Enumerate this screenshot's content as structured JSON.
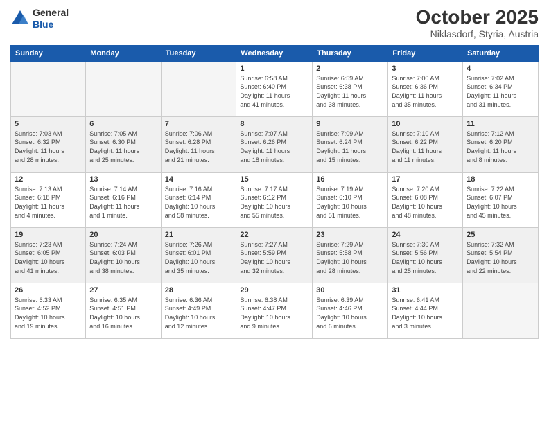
{
  "header": {
    "logo_line1": "General",
    "logo_line2": "Blue",
    "title": "October 2025",
    "subtitle": "Niklasdorf, Styria, Austria"
  },
  "days_of_week": [
    "Sunday",
    "Monday",
    "Tuesday",
    "Wednesday",
    "Thursday",
    "Friday",
    "Saturday"
  ],
  "weeks": [
    [
      {
        "day": "",
        "detail": ""
      },
      {
        "day": "",
        "detail": ""
      },
      {
        "day": "",
        "detail": ""
      },
      {
        "day": "1",
        "detail": "Sunrise: 6:58 AM\nSunset: 6:40 PM\nDaylight: 11 hours\nand 41 minutes."
      },
      {
        "day": "2",
        "detail": "Sunrise: 6:59 AM\nSunset: 6:38 PM\nDaylight: 11 hours\nand 38 minutes."
      },
      {
        "day": "3",
        "detail": "Sunrise: 7:00 AM\nSunset: 6:36 PM\nDaylight: 11 hours\nand 35 minutes."
      },
      {
        "day": "4",
        "detail": "Sunrise: 7:02 AM\nSunset: 6:34 PM\nDaylight: 11 hours\nand 31 minutes."
      }
    ],
    [
      {
        "day": "5",
        "detail": "Sunrise: 7:03 AM\nSunset: 6:32 PM\nDaylight: 11 hours\nand 28 minutes."
      },
      {
        "day": "6",
        "detail": "Sunrise: 7:05 AM\nSunset: 6:30 PM\nDaylight: 11 hours\nand 25 minutes."
      },
      {
        "day": "7",
        "detail": "Sunrise: 7:06 AM\nSunset: 6:28 PM\nDaylight: 11 hours\nand 21 minutes."
      },
      {
        "day": "8",
        "detail": "Sunrise: 7:07 AM\nSunset: 6:26 PM\nDaylight: 11 hours\nand 18 minutes."
      },
      {
        "day": "9",
        "detail": "Sunrise: 7:09 AM\nSunset: 6:24 PM\nDaylight: 11 hours\nand 15 minutes."
      },
      {
        "day": "10",
        "detail": "Sunrise: 7:10 AM\nSunset: 6:22 PM\nDaylight: 11 hours\nand 11 minutes."
      },
      {
        "day": "11",
        "detail": "Sunrise: 7:12 AM\nSunset: 6:20 PM\nDaylight: 11 hours\nand 8 minutes."
      }
    ],
    [
      {
        "day": "12",
        "detail": "Sunrise: 7:13 AM\nSunset: 6:18 PM\nDaylight: 11 hours\nand 4 minutes."
      },
      {
        "day": "13",
        "detail": "Sunrise: 7:14 AM\nSunset: 6:16 PM\nDaylight: 11 hours\nand 1 minute."
      },
      {
        "day": "14",
        "detail": "Sunrise: 7:16 AM\nSunset: 6:14 PM\nDaylight: 10 hours\nand 58 minutes."
      },
      {
        "day": "15",
        "detail": "Sunrise: 7:17 AM\nSunset: 6:12 PM\nDaylight: 10 hours\nand 55 minutes."
      },
      {
        "day": "16",
        "detail": "Sunrise: 7:19 AM\nSunset: 6:10 PM\nDaylight: 10 hours\nand 51 minutes."
      },
      {
        "day": "17",
        "detail": "Sunrise: 7:20 AM\nSunset: 6:08 PM\nDaylight: 10 hours\nand 48 minutes."
      },
      {
        "day": "18",
        "detail": "Sunrise: 7:22 AM\nSunset: 6:07 PM\nDaylight: 10 hours\nand 45 minutes."
      }
    ],
    [
      {
        "day": "19",
        "detail": "Sunrise: 7:23 AM\nSunset: 6:05 PM\nDaylight: 10 hours\nand 41 minutes."
      },
      {
        "day": "20",
        "detail": "Sunrise: 7:24 AM\nSunset: 6:03 PM\nDaylight: 10 hours\nand 38 minutes."
      },
      {
        "day": "21",
        "detail": "Sunrise: 7:26 AM\nSunset: 6:01 PM\nDaylight: 10 hours\nand 35 minutes."
      },
      {
        "day": "22",
        "detail": "Sunrise: 7:27 AM\nSunset: 5:59 PM\nDaylight: 10 hours\nand 32 minutes."
      },
      {
        "day": "23",
        "detail": "Sunrise: 7:29 AM\nSunset: 5:58 PM\nDaylight: 10 hours\nand 28 minutes."
      },
      {
        "day": "24",
        "detail": "Sunrise: 7:30 AM\nSunset: 5:56 PM\nDaylight: 10 hours\nand 25 minutes."
      },
      {
        "day": "25",
        "detail": "Sunrise: 7:32 AM\nSunset: 5:54 PM\nDaylight: 10 hours\nand 22 minutes."
      }
    ],
    [
      {
        "day": "26",
        "detail": "Sunrise: 6:33 AM\nSunset: 4:52 PM\nDaylight: 10 hours\nand 19 minutes."
      },
      {
        "day": "27",
        "detail": "Sunrise: 6:35 AM\nSunset: 4:51 PM\nDaylight: 10 hours\nand 16 minutes."
      },
      {
        "day": "28",
        "detail": "Sunrise: 6:36 AM\nSunset: 4:49 PM\nDaylight: 10 hours\nand 12 minutes."
      },
      {
        "day": "29",
        "detail": "Sunrise: 6:38 AM\nSunset: 4:47 PM\nDaylight: 10 hours\nand 9 minutes."
      },
      {
        "day": "30",
        "detail": "Sunrise: 6:39 AM\nSunset: 4:46 PM\nDaylight: 10 hours\nand 6 minutes."
      },
      {
        "day": "31",
        "detail": "Sunrise: 6:41 AM\nSunset: 4:44 PM\nDaylight: 10 hours\nand 3 minutes."
      },
      {
        "day": "",
        "detail": ""
      }
    ]
  ]
}
